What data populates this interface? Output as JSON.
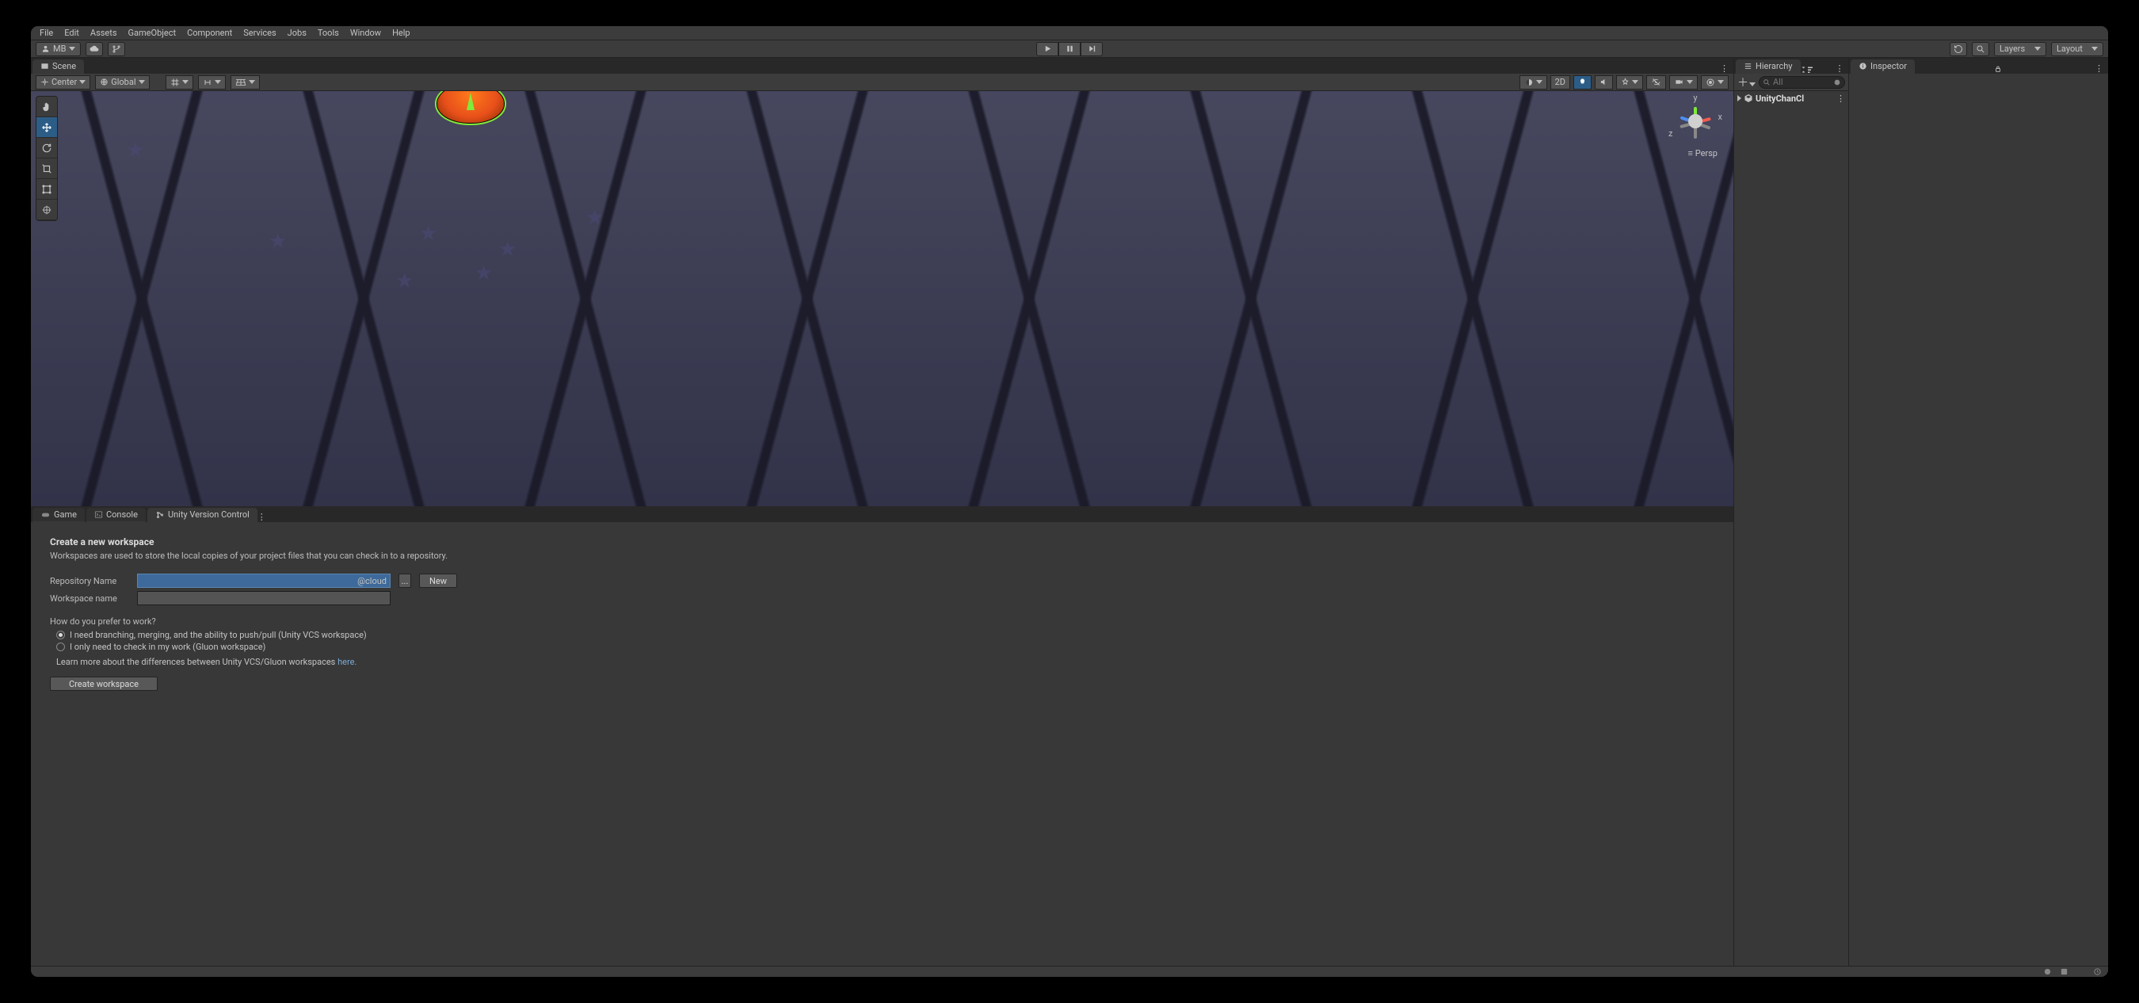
{
  "menu": {
    "items": [
      "File",
      "Edit",
      "Assets",
      "GameObject",
      "Component",
      "Services",
      "Jobs",
      "Tools",
      "Window",
      "Help"
    ]
  },
  "toolbar": {
    "account": "MB",
    "layers": "Layers",
    "layout": "Layout"
  },
  "scene": {
    "tab": "Scene",
    "pivot": "Center",
    "space": "Global",
    "mode2d": "2D",
    "persp": "Persp",
    "axes": {
      "x": "x",
      "y": "y",
      "z": "z"
    }
  },
  "hierarchy": {
    "tab": "Hierarchy",
    "searchPlaceholder": "All",
    "root": "UnityChanCl"
  },
  "inspector": {
    "tab": "Inspector"
  },
  "bottomTabs": {
    "game": "Game",
    "console": "Console",
    "vcs": "Unity Version Control"
  },
  "vcs": {
    "title": "Create a new workspace",
    "sub": "Workspaces are used to store the local copies of your project files that you can check in to a repository.",
    "repoLabel": "Repository Name",
    "repoValue": "@cloud",
    "browse": "...",
    "newBtn": "New",
    "wsLabel": "Workspace name",
    "wsValue": "",
    "question": "How do you prefer to work?",
    "opt1": "I need branching, merging, and the ability to push/pull (Unity VCS workspace)",
    "opt2": "I only need to check in my work (Gluon workspace)",
    "learn": "Learn more about the differences between Unity VCS/Gluon workspaces ",
    "learnLink": "here",
    "create": "Create workspace"
  }
}
